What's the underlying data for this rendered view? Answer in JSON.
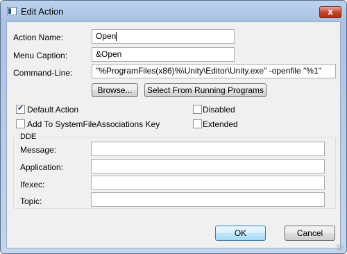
{
  "window": {
    "title": "Edit Action",
    "close_label": "x"
  },
  "form": {
    "action_name": {
      "label": "Action Name:",
      "value": "Open"
    },
    "menu_caption": {
      "label": "Menu Caption:",
      "value": "&Open"
    },
    "command_line": {
      "label": "Command-Line:",
      "value": "\"%ProgramFiles(x86)%\\Unity\\Editor\\Unity.exe\" -openfile \"%1\""
    }
  },
  "buttons": {
    "browse": "Browse...",
    "select_running": "Select From Running Programs",
    "ok": "OK",
    "cancel": "Cancel"
  },
  "options": {
    "default_action": {
      "label": "Default Action",
      "checked": true
    },
    "add_to_sfa": {
      "label": "Add To SystemFileAssociations Key",
      "checked": false
    },
    "disabled": {
      "label": "Disabled",
      "checked": false
    },
    "extended": {
      "label": "Extended",
      "checked": false
    }
  },
  "dde": {
    "caption": "DDE",
    "message": {
      "label": "Message:",
      "value": ""
    },
    "application": {
      "label": "Application:",
      "value": ""
    },
    "ifexec": {
      "label": "Ifexec:",
      "value": ""
    },
    "topic": {
      "label": "Topic:",
      "value": ""
    }
  }
}
